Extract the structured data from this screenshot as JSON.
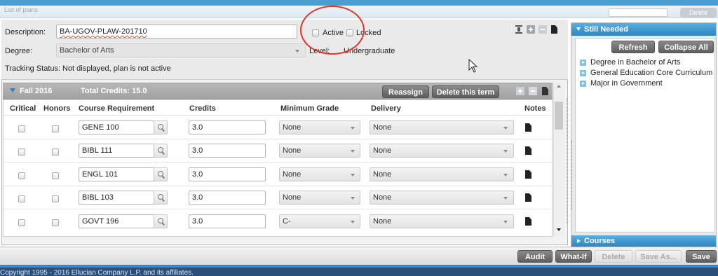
{
  "list_bar": {
    "title": "List of plans",
    "delete_label": "Delete"
  },
  "plan": {
    "description_label": "Description:",
    "description_value": "BA-UGOV-PLAW-201710",
    "active_label": "Active",
    "locked_label": "Locked",
    "degree_label": "Degree:",
    "degree_value": "Bachelor of Arts",
    "level_label": "Level:",
    "level_value": "Undergraduate",
    "tracking_label": "Tracking Status:",
    "tracking_value": "Not displayed, plan is not active"
  },
  "term": {
    "name": "Fall 2016",
    "total_credits": "Total Credits: 15.0",
    "reassign_label": "Reassign",
    "delete_term_label": "Delete this term"
  },
  "columns": {
    "critical": "Critical",
    "honors": "Honors",
    "course": "Course Requirement",
    "credits": "Credits",
    "min_grade": "Minimum Grade",
    "delivery": "Delivery",
    "notes": "Notes"
  },
  "courses": [
    {
      "course": "GENE 100",
      "credits": "3.0",
      "grade": "None",
      "delivery": "None"
    },
    {
      "course": "BIBL 111",
      "credits": "3.0",
      "grade": "None",
      "delivery": "None"
    },
    {
      "course": "ENGL 101",
      "credits": "3.0",
      "grade": "None",
      "delivery": "None"
    },
    {
      "course": "BIBL 103",
      "credits": "3.0",
      "grade": "None",
      "delivery": "None"
    },
    {
      "course": "GOVT 196",
      "credits": "3.0",
      "grade": "C-",
      "delivery": "None"
    }
  ],
  "still_needed": {
    "title": "Still Needed",
    "refresh_label": "Refresh",
    "collapse_label": "Collapse All",
    "items": [
      "Degree in Bachelor of Arts",
      "General Education Core Curriculum",
      "Major in Government"
    ]
  },
  "courses_panel": {
    "title": "Courses"
  },
  "bottom": {
    "audit_label": "Audit",
    "whatif_label": "What-If",
    "delete_label": "Delete",
    "saveas_label": "Save As...",
    "save_label": "Save"
  },
  "footer": {
    "copyright": "Copyright 1995 - 2016 Ellucian Company L.P. and its affiliates."
  },
  "colors": {
    "accent_blue": "#2c86c2",
    "annotation_red": "#e2342b",
    "footer_navy": "#2a4f7a"
  }
}
